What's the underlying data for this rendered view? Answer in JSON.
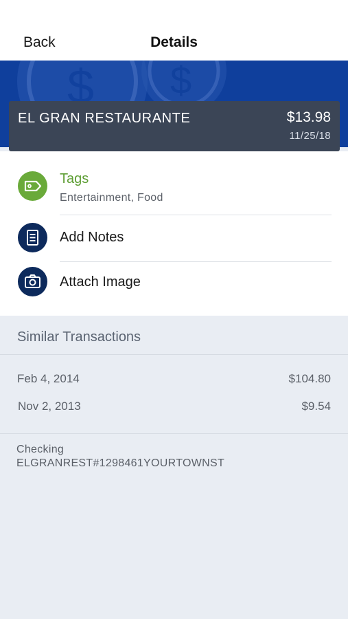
{
  "nav": {
    "back_label": "Back",
    "title": "Details"
  },
  "transaction": {
    "merchant": "EL GRAN RESTAURANTE",
    "amount": "$13.98",
    "date": "11/25/18"
  },
  "actions": [
    {
      "label": "Tags",
      "sublabel": "Entertainment, Food",
      "icon": "tag-icon",
      "color": "#6aaa3a"
    },
    {
      "label": "Add Notes",
      "icon": "notes-icon",
      "color": "#0d2a5c"
    },
    {
      "label": "Attach Image",
      "icon": "camera-icon",
      "color": "#0d2a5c"
    }
  ],
  "similar": {
    "title": "Similar Transactions",
    "rows": [
      {
        "date": "Feb 4, 2014",
        "amount": "$104.80"
      },
      {
        "date": "Nov 2, 2013",
        "amount": "$9.54"
      }
    ]
  },
  "account": {
    "name": "Checking",
    "description": "ELGRANREST#1298461YOURTOWNST"
  },
  "colors": {
    "banner": "#0f3f9c",
    "card": "#3b4556",
    "tags_green": "#6aaa3a",
    "navy": "#0d2a5c"
  }
}
